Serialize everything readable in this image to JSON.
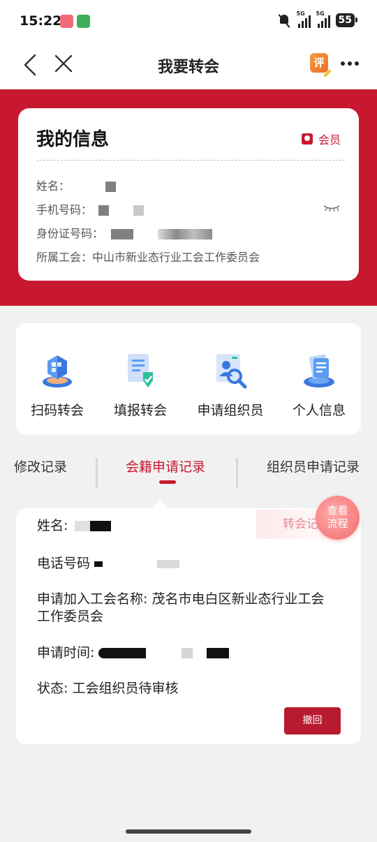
{
  "status_bar": {
    "time": "15:22",
    "net1": "5G",
    "net2": "5G",
    "battery": "55"
  },
  "nav": {
    "title": "我要转会",
    "review_label": "评"
  },
  "info_card": {
    "title": "我的信息",
    "badge": "会员",
    "name_label": "姓名：",
    "phone_label": "手机号码：",
    "id_label": "身份证号码：",
    "union_label": "所属工会：",
    "union_value": "中山市新业态行业工会工作委员会"
  },
  "actions": [
    {
      "label": "扫码转会",
      "icon": "scan-transfer-icon"
    },
    {
      "label": "填报转会",
      "icon": "fill-form-icon"
    },
    {
      "label": "申请组织员",
      "icon": "apply-organizer-icon"
    },
    {
      "label": "个人信息",
      "icon": "personal-info-icon"
    }
  ],
  "tabs": [
    {
      "label": "修改记录",
      "active": false
    },
    {
      "label": "会籍申请记录",
      "active": true
    },
    {
      "label": "组织员申请记录",
      "active": false
    }
  ],
  "record": {
    "name_label": "姓名:",
    "phone_label": "电话号码",
    "union_label": "申请加入工会名称:",
    "union_line1": "茂名市电白区新业态行业工会",
    "union_line2": "工作委员会",
    "time_label": "申请时间:",
    "status_label": "状态:",
    "status_value": "工会组织员待审核",
    "type_tag": "转会记录",
    "withdraw_label": "撤回"
  },
  "flow_button": {
    "line1": "查看",
    "line2": "流程"
  },
  "colors": {
    "brand_red": "#c8182f",
    "button_red": "#b81a30",
    "page_bg": "#f1f1f1"
  }
}
